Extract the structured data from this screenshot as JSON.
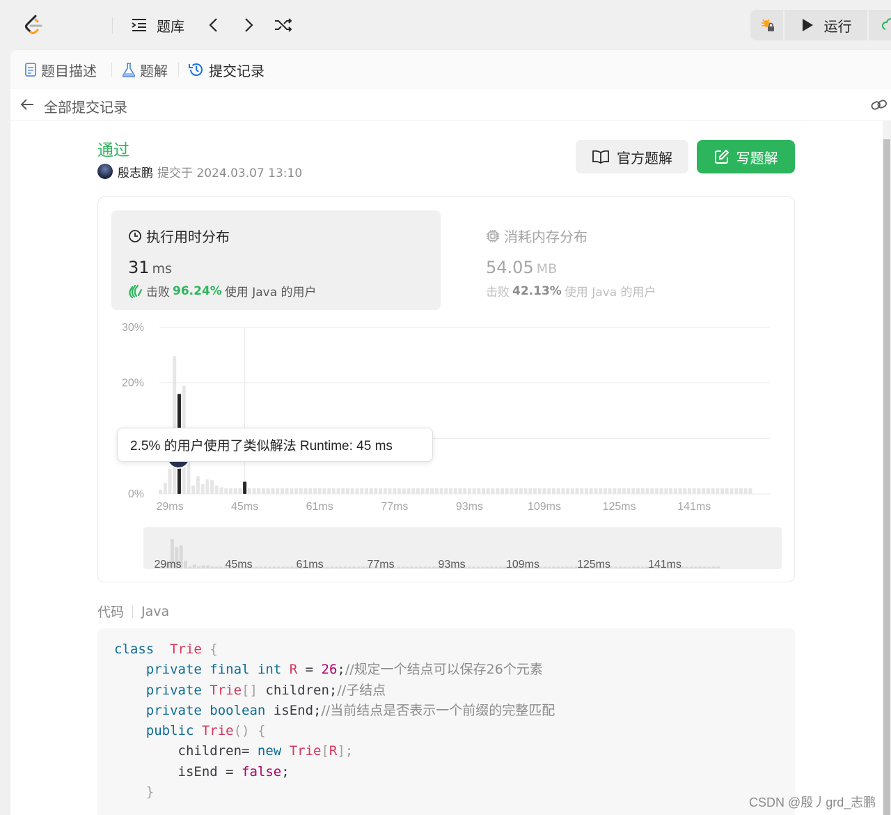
{
  "topbar": {
    "problem_bank_label": "题库",
    "run_label": "运行"
  },
  "tabs": [
    {
      "label": "题目描述"
    },
    {
      "label": "题解"
    },
    {
      "label": "提交记录"
    }
  ],
  "back": {
    "label": "全部提交记录"
  },
  "submission": {
    "status": "通过",
    "user": "殷志鹏",
    "submitted_at": "提交于 2024.03.07 13:10"
  },
  "actions": {
    "official_solution": "官方题解",
    "write_solution": "写题解"
  },
  "runtime": {
    "title": "执行用时分布",
    "value": "31",
    "unit": "ms",
    "beat_prefix": "击败",
    "beat_pct": "96.24%",
    "beat_suffix": "使用 Java 的用户"
  },
  "memory": {
    "title": "消耗内存分布",
    "value": "54.05",
    "unit": "MB",
    "beat_prefix": "击败",
    "beat_pct": "42.13%",
    "beat_suffix": "使用 Java 的用户"
  },
  "tooltip": "2.5% 的用户使用了类似解法 Runtime: 45 ms",
  "colors": {
    "accent_green": "#2db55d",
    "highlight_bar": "#262626",
    "bar": "#e6e6e6"
  },
  "chart_data": {
    "type": "bar",
    "title": "",
    "xlabel": "",
    "ylabel": "",
    "ylim": [
      0,
      30
    ],
    "y_ticks": [
      "30%",
      "20%",
      "0%"
    ],
    "x_ticks": [
      "29ms",
      "45ms",
      "61ms",
      "77ms",
      "93ms",
      "109ms",
      "125ms",
      "141ms"
    ],
    "x_start": 27,
    "x_step": 1,
    "values": [
      0.8,
      2.0,
      4.5,
      24.8,
      18.0,
      19.5,
      6.5,
      1.5,
      3.2,
      1.8,
      2.6,
      2.5,
      1.5,
      1.2,
      1.0,
      1.0,
      1.0,
      1.0,
      1.0,
      1.0,
      1.0,
      1.0,
      1.0,
      1.0,
      1.0,
      1.0,
      1.0,
      1.0,
      1.0,
      1.0,
      1.0,
      1.0,
      1.0,
      1.0,
      1.0,
      1.0,
      1.0,
      1.0,
      1.0,
      1.0,
      1.0,
      1.0,
      1.0,
      1.0,
      1.0,
      1.0,
      1.0,
      1.0,
      1.0,
      1.0,
      1.0,
      1.0,
      1.0,
      1.0,
      1.0,
      1.0,
      1.0,
      1.0,
      1.0,
      1.0,
      1.0,
      1.0,
      1.0,
      1.0,
      1.0,
      1.0,
      1.0,
      1.0,
      1.0,
      1.0,
      1.0,
      1.0,
      1.0,
      1.0,
      1.0,
      1.0,
      1.0,
      1.0,
      1.0,
      1.0,
      1.0,
      1.0,
      1.0,
      1.0,
      1.0,
      1.0,
      1.0,
      1.0,
      1.0,
      1.0,
      1.0,
      1.0,
      1.0,
      1.0,
      1.0,
      1.0,
      1.0,
      1.0,
      1.0,
      1.0,
      1.0,
      1.0,
      1.0,
      1.0,
      1.0,
      1.0,
      1.0,
      1.0,
      1.0,
      1.0,
      1.0,
      1.0,
      1.0,
      1.0,
      1.0,
      1.0,
      1.0,
      1.0,
      1.0,
      1.0,
      1.0,
      1.0,
      1.0,
      1.0,
      1.0,
      1.0,
      1.0
    ],
    "highlight_ms": [
      31,
      45
    ],
    "grid": true
  },
  "code_header": {
    "label": "代码",
    "language": "Java"
  },
  "code_lines": [
    [
      [
        "kw",
        "class"
      ],
      [
        "",
        "  "
      ],
      [
        "ty",
        "Trie"
      ],
      [
        "pn",
        " {"
      ]
    ],
    [
      [
        "",
        "    "
      ],
      [
        "kw",
        "private"
      ],
      [
        "",
        " "
      ],
      [
        "kw",
        "final"
      ],
      [
        "",
        " "
      ],
      [
        "kw",
        "int"
      ],
      [
        "",
        " "
      ],
      [
        "ty",
        "R"
      ],
      [
        "",
        " = "
      ],
      [
        "num",
        "26"
      ],
      [
        "",
        ";"
      ],
      [
        "cm",
        "//规定一个结点可以保存26个元素"
      ]
    ],
    [
      [
        "",
        "    "
      ],
      [
        "kw",
        "private"
      ],
      [
        "",
        " "
      ],
      [
        "ty",
        "Trie"
      ],
      [
        "pn",
        "[]"
      ],
      [
        "",
        " children;"
      ],
      [
        "cm",
        "//子结点"
      ]
    ],
    [
      [
        "",
        "    "
      ],
      [
        "kw",
        "private"
      ],
      [
        "",
        " "
      ],
      [
        "kw",
        "boolean"
      ],
      [
        "",
        " isEnd;"
      ],
      [
        "cm",
        "//当前结点是否表示一个前缀的完整匹配"
      ]
    ],
    [
      [
        "",
        "    "
      ],
      [
        "kw",
        "public"
      ],
      [
        "",
        " "
      ],
      [
        "ty",
        "Trie"
      ],
      [
        "pn",
        "() {"
      ]
    ],
    [
      [
        "",
        "        children= "
      ],
      [
        "kw",
        "new"
      ],
      [
        "",
        " "
      ],
      [
        "ty",
        "Trie"
      ],
      [
        "pn",
        "["
      ],
      [
        "ty",
        "R"
      ],
      [
        "pn",
        "];"
      ]
    ],
    [
      [
        "",
        "        isEnd = "
      ],
      [
        "num",
        "false"
      ],
      [
        "",
        ";"
      ]
    ],
    [
      [
        "pn",
        "    }"
      ]
    ]
  ],
  "watermark": "CSDN @殷丿grd_志鹏"
}
